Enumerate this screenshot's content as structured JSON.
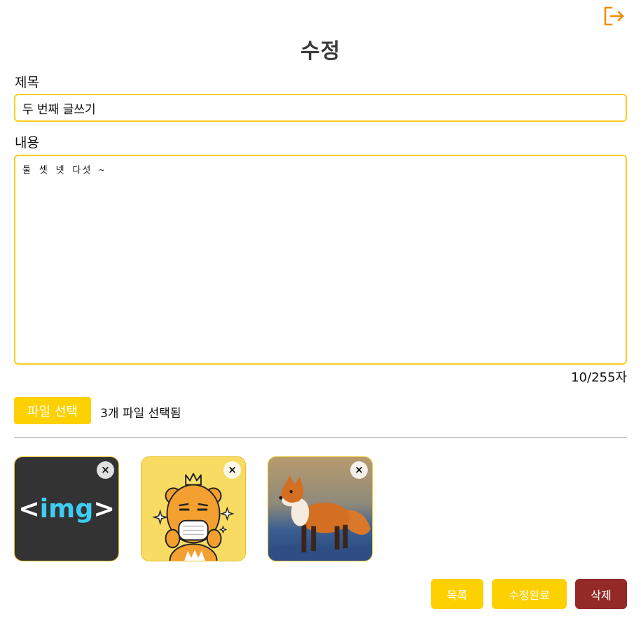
{
  "header": {
    "logout_icon": "logout-icon",
    "title": "수정"
  },
  "form": {
    "title_label": "제목",
    "title_value": "두 번째 글쓰기",
    "content_label": "내용",
    "content_value": "둘 셋 넷 다섯 ~",
    "char_count": "10/255자"
  },
  "files": {
    "button_label": "파일 선택",
    "status": "3개 파일 선택됨",
    "thumbnails": [
      {
        "name": "img-logo",
        "text": "<img>"
      },
      {
        "name": "masked-character"
      },
      {
        "name": "fox-photo"
      }
    ],
    "remove_glyph": "×"
  },
  "actions": {
    "list_label": "목록",
    "save_label": "수정완료",
    "delete_label": "삭제"
  },
  "colors": {
    "accent_yellow": "#fdd000",
    "border_yellow": "#f9cd1f",
    "delete_red": "#932a27",
    "icon_orange": "#f08c00"
  }
}
